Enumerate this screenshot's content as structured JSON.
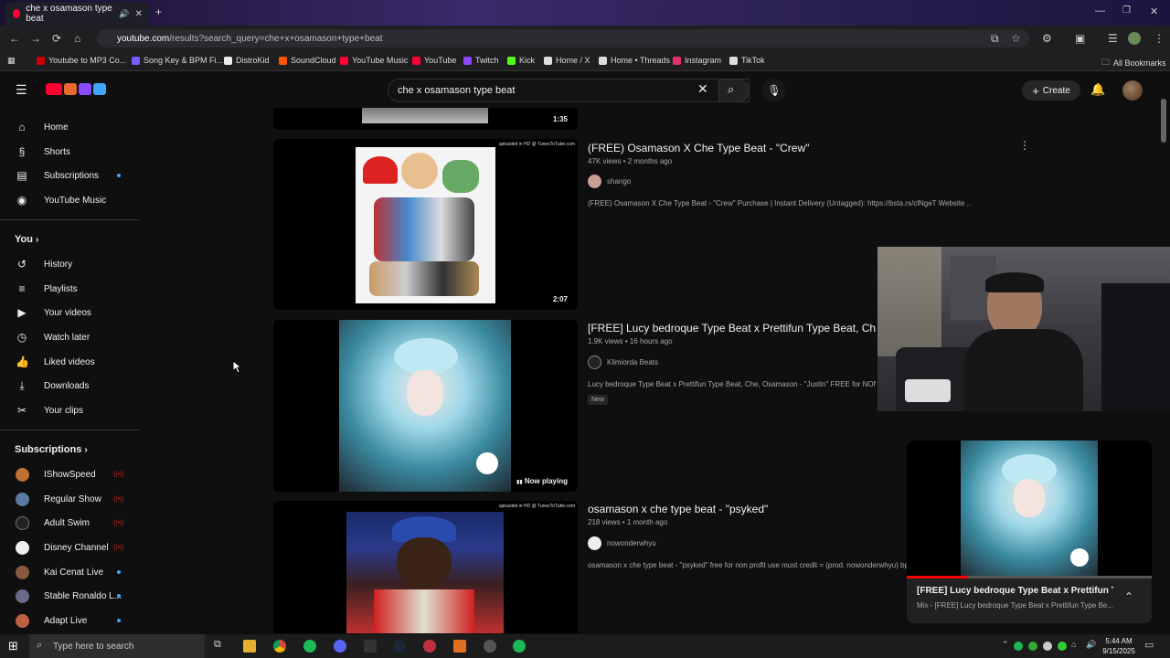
{
  "browser": {
    "tab_title": "che x osamason type beat",
    "url_host": "youtube.com",
    "url_path": "/results?search_query=che+x+osamason+type+beat",
    "bookmarks": [
      {
        "label": "Youtube to MP3 Co...",
        "color": "#c00"
      },
      {
        "label": "Song Key & BPM Fi...",
        "color": "#7b5cff"
      },
      {
        "label": "DistroKid",
        "color": "#eee"
      },
      {
        "label": "SoundCloud",
        "color": "#ff5500"
      },
      {
        "label": "YouTube Music",
        "color": "#ff0033"
      },
      {
        "label": "YouTube",
        "color": "#ff0033"
      },
      {
        "label": "Twitch",
        "color": "#9146ff"
      },
      {
        "label": "Kick",
        "color": "#53fc18"
      },
      {
        "label": "Home / X",
        "color": "#ddd"
      },
      {
        "label": "Home • Threads",
        "color": "#ddd"
      },
      {
        "label": "Instagram",
        "color": "#e1306c"
      },
      {
        "label": "TikTok",
        "color": "#ddd"
      }
    ],
    "all_bookmarks": "All Bookmarks"
  },
  "header": {
    "search_value": "che x osamason type beat",
    "create_label": "Create"
  },
  "sidebar": {
    "main": [
      "Home",
      "Shorts",
      "Subscriptions",
      "YouTube Music"
    ],
    "you_heading": "You",
    "you_items": [
      "History",
      "Playlists",
      "Your videos",
      "Watch later",
      "Liked videos",
      "Downloads",
      "Your clips"
    ],
    "subs_heading": "Subscriptions",
    "subscriptions": [
      {
        "name": "IShowSpeed",
        "status": "live",
        "color": "#c07030"
      },
      {
        "name": "Regular Show",
        "status": "live",
        "color": "#5a7aa0"
      },
      {
        "name": "Adult Swim",
        "status": "live",
        "color": "#222"
      },
      {
        "name": "Disney Channel",
        "status": "live",
        "color": "#eee"
      },
      {
        "name": "Kai Cenat Live",
        "status": "new",
        "color": "#8a5a40"
      },
      {
        "name": "Stable Ronaldo L...",
        "status": "new",
        "color": "#6a6a8a"
      },
      {
        "name": "Adapt Live",
        "status": "new",
        "color": "#c06040"
      }
    ]
  },
  "results": [
    {
      "duration": "1:35"
    },
    {
      "title": "(FREE) Osamason X Che Type Beat - \"Crew\"",
      "meta": "47K views • 2 months ago",
      "channel": "shango",
      "description": "(FREE) Osamason X Che Type Beat - \"Crew\" Purchase | Instant Delivery (Untagged): https://bsta.rs/clNgeT Website ...",
      "duration": "2:07",
      "watermark": "uploaded in HD @ TunesToTube.com"
    },
    {
      "title": "[FREE] Lucy bedroque Type Beat x Prettifun Type Beat, Che,",
      "meta": "1.9K views • 16 hours ago",
      "channel": "Klimiorda Beats",
      "description": "Lucy bedroque Type Beat x Prettifun Type Beat, Che, Osamason - \"Justin\" FREE for NON P",
      "badge": "New",
      "status": "Now playing"
    },
    {
      "title": "osamason x che type beat - \"psyked\"",
      "meta": "218 views • 1 month ago",
      "channel": "nowonderwhyu",
      "description": "osamason x che type beat - \"psyked\" free for non profit use must credit = (prod. nowonderwhyu) bp",
      "watermark": "uploaded in HD @ TunesToTube.com"
    }
  ],
  "miniplayer": {
    "title": "[FREE] Lucy bedroque Type Beat x Prettifun Typ...",
    "subtitle": "Mix - [FREE] Lucy bedroque Type Beat x Prettifun Type Be...",
    "progress": 0.25
  },
  "taskbar": {
    "search_placeholder": "Type here to search",
    "time": "5:44 AM",
    "date": "9/15/2025"
  }
}
